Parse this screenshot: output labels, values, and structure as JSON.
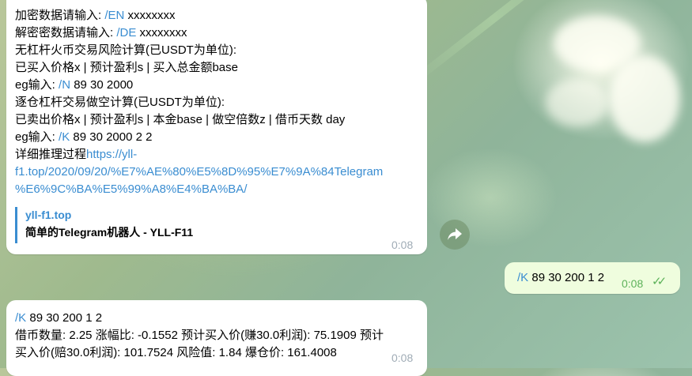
{
  "messages": {
    "first": {
      "lines": {
        "l1_text": "加密数据请输入: ",
        "l1_cmd": "/EN",
        "l1_arg": " xxxxxxxx",
        "l2_text": "解密密数据请输入: ",
        "l2_cmd": "/DE",
        "l2_arg": " xxxxxxxx",
        "l3": "无杠杆火币交易风险计算(已USDT为单位):",
        "l4": "已买入价格x | 预计盈利s | 买入总金额base",
        "l5_text": "eg输入: ",
        "l5_cmd": "/N",
        "l5_arg": " 89 30 2000",
        "l6": "逐仓杠杆交易做空计算(已USDT为单位):",
        "l7": "已卖出价格x | 预计盈利s | 本金base | 做空倍数z | 借币天数 day",
        "l8_text": "eg输入: ",
        "l8_cmd": "/K",
        "l8_arg": " 89 30 2000 2 2",
        "l9_text": "详细推理过程",
        "link_1": "https://yll-",
        "link_2": "f1.top/2020/09/20/%E7%AE%80%E5%8D%95%E7%9A%84Telegram",
        "link_3": "%E6%9C%BA%E5%99%A8%E4%BA%BA/"
      },
      "preview": {
        "site": "yll-f1.top",
        "title": "简单的Telegram机器人 - YLL-F11"
      },
      "time": "0:08"
    },
    "outgoing": {
      "cmd": "/K",
      "arg": " 89 30 200 1 2",
      "time": "0:08",
      "ticks": "✓✓"
    },
    "second": {
      "l1_cmd": "/K",
      "l1_arg": " 89 30 200 1 2",
      "l2": "借币数量: 2.25  涨幅比: -0.1552  预计买入价(赚30.0利润): 75.1909  预计",
      "l3": "买入价(赔30.0利润): 101.7524  风险值: 1.84  爆仓价: 161.4008",
      "time": "0:08"
    }
  },
  "icons": {
    "share": "share-arrow-icon",
    "read_receipt": "double-check-icon"
  },
  "colors": {
    "link": "#3a8dd1",
    "outgoing_bubble": "#effdde",
    "read_ticks": "#5db25a"
  }
}
